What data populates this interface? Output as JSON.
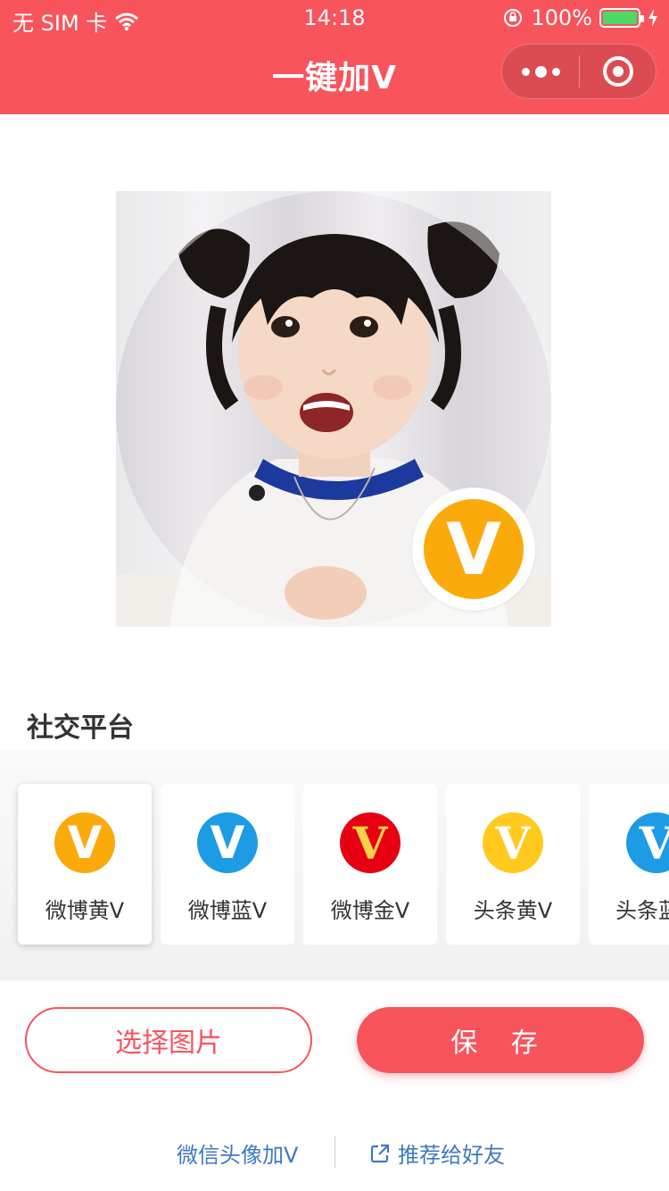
{
  "status_bar": {
    "carrier": "无 SIM 卡",
    "time": "14:18",
    "battery": "100%",
    "battery_level": 1.0
  },
  "nav": {
    "title": "一键加V"
  },
  "preview": {
    "badge_text": "V",
    "badge_color": "#fbaa0c"
  },
  "section": {
    "title": "社交平台"
  },
  "platforms": [
    {
      "label": "微博黄V",
      "icon_text": "V",
      "color": "#fbaa0c",
      "text_color": "#ffffff",
      "selected": true
    },
    {
      "label": "微博蓝V",
      "icon_text": "V",
      "color": "#1d9be5",
      "text_color": "#ffffff",
      "selected": false
    },
    {
      "label": "微博金V",
      "icon_text": "V",
      "color": "#e60012",
      "text_color": "#f9d24a",
      "selected": false
    },
    {
      "label": "头条黄V",
      "icon_text": "V",
      "color": "#ffc91e",
      "text_color": "#ffffff",
      "selected": false
    },
    {
      "label": "头条蓝",
      "icon_text": "V",
      "color": "#1d9be5",
      "text_color": "#ffffff",
      "selected": false
    }
  ],
  "buttons": {
    "select_image": "选择图片",
    "save": "保 存"
  },
  "footer": {
    "wechat_link": "微信头像加V",
    "share_link": "推荐给好友"
  },
  "colors": {
    "brand": "#f7545c",
    "link": "#3d78c1"
  }
}
